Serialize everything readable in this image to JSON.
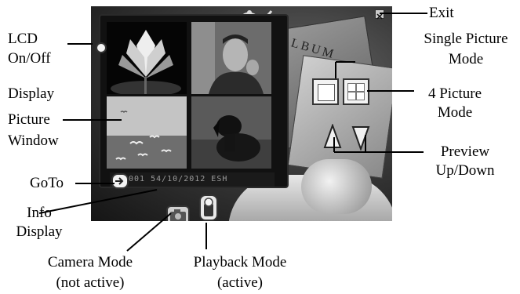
{
  "labels": {
    "exit": "Exit",
    "lcd_line1": "LCD",
    "lcd_line2": "On/Off",
    "single_line1": "Single Picture",
    "single_line2": "Mode",
    "display_line1": "Display",
    "display_line2": "Picture",
    "display_line3": "Window",
    "four_line1": "4 Picture",
    "four_line2": "Mode",
    "preview_line1": "Preview",
    "preview_line2": "Up/Down",
    "goto": "GoTo",
    "info_line1": "Info",
    "info_line2": "Display",
    "camera_line1": "Camera Mode",
    "camera_line2": "(not active)",
    "playback_line1": "Playback Mode",
    "playback_line2": "(active)"
  },
  "app": {
    "album_text": "ALBUM",
    "info_readout": "001 54/10/2012 ESH"
  }
}
